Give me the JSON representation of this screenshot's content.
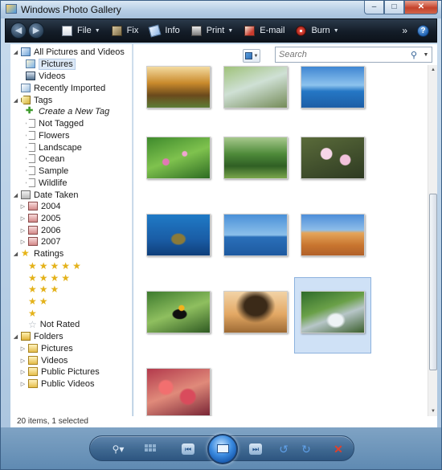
{
  "window": {
    "title": "Windows Photo Gallery",
    "caption": {
      "minimize": "–",
      "maximize": "□",
      "close": "✕"
    }
  },
  "toolbar": {
    "back_icon": "back-arrow-icon",
    "forward_icon": "forward-arrow-icon",
    "items": [
      {
        "label": "File",
        "icon": "file-icon",
        "dropdown": true
      },
      {
        "label": "Fix",
        "icon": "fix-icon",
        "dropdown": false
      },
      {
        "label": "Info",
        "icon": "info-icon",
        "dropdown": false
      },
      {
        "label": "Print",
        "icon": "printer-icon",
        "dropdown": true
      },
      {
        "label": "E-mail",
        "icon": "email-icon",
        "dropdown": false
      },
      {
        "label": "Burn",
        "icon": "burn-disc-icon",
        "dropdown": true
      }
    ],
    "overflow": "»",
    "help": "?"
  },
  "nav": {
    "all": "All Pictures and Videos",
    "pictures": "Pictures",
    "videos": "Videos",
    "recently_imported": "Recently Imported",
    "tags": "Tags",
    "tag_items": [
      "Create a New Tag",
      "Not Tagged",
      "Flowers",
      "Landscape",
      "Ocean",
      "Sample",
      "Wildlife"
    ],
    "date_taken": "Date Taken",
    "years": [
      "2004",
      "2005",
      "2006",
      "2007"
    ],
    "ratings": "Ratings",
    "not_rated": "Not Rated",
    "folders": "Folders",
    "folder_items": [
      "Pictures",
      "Videos",
      "Public Pictures",
      "Public Videos"
    ]
  },
  "search": {
    "placeholder": "Search"
  },
  "gallery": {
    "thumbnails": [
      {
        "name": "autumn-landscape"
      },
      {
        "name": "creek"
      },
      {
        "name": "ocean-island"
      },
      {
        "name": "green-plants-flowers"
      },
      {
        "name": "forest-path"
      },
      {
        "name": "pink-orchid"
      },
      {
        "name": "sea-turtle"
      },
      {
        "name": "whale-tail"
      },
      {
        "name": "desert-oryx"
      },
      {
        "name": "toucan"
      },
      {
        "name": "tree-sunset"
      },
      {
        "name": "waterfall",
        "selected": true
      },
      {
        "name": "red-coral-plant"
      }
    ]
  },
  "status": {
    "text": "20 items, 1 selected"
  },
  "controls": {
    "zoom": "⚲",
    "prev": "⏮",
    "next": "⏭",
    "rotate_left": "↺",
    "rotate_right": "↻",
    "delete": "✕"
  }
}
